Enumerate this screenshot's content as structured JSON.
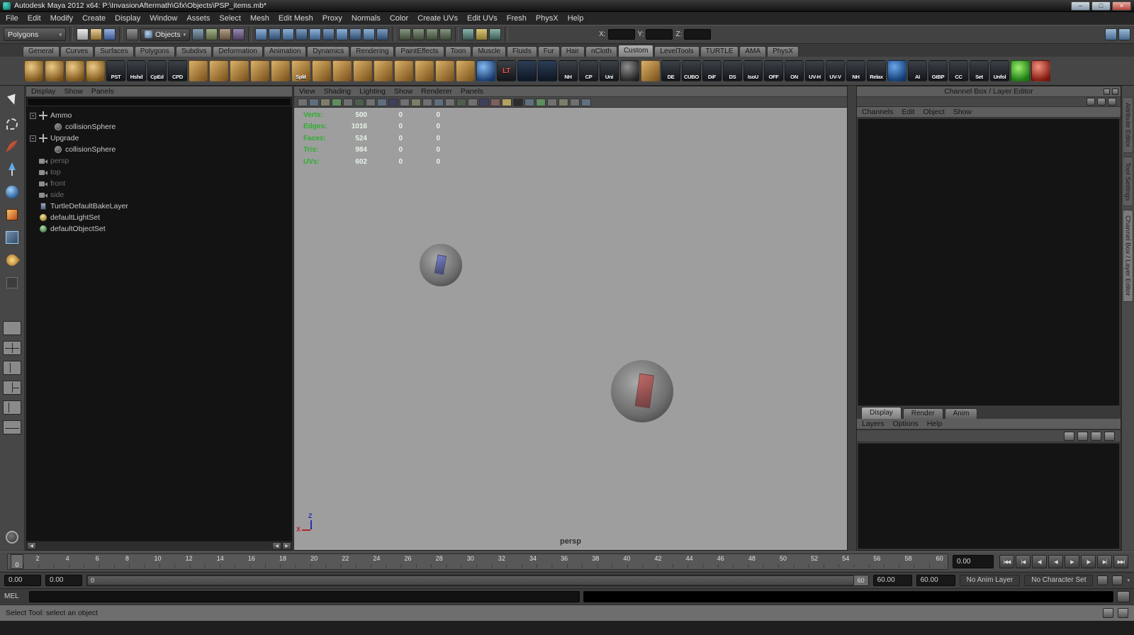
{
  "window": {
    "title": "Autodesk Maya 2012 x64: P:\\InvasionAftermath\\Gfx\\Objects\\PSP_items.mb*",
    "buttons": {
      "minimize": "–",
      "maximize": "□",
      "close": "×"
    }
  },
  "menu_bar": [
    "File",
    "Edit",
    "Modify",
    "Create",
    "Display",
    "Window",
    "Assets",
    "Select",
    "Mesh",
    "Edit Mesh",
    "Proxy",
    "Normals",
    "Color",
    "Create UVs",
    "Edit UVs",
    "Fresh",
    "PhysX",
    "Help"
  ],
  "status_line": {
    "menu_set": "Polygons",
    "selection_combo": "Objects",
    "file_icons": [
      "st-new",
      "st-open",
      "st-save"
    ],
    "mode_icons": [
      "st-hier"
    ],
    "mask_icons": [
      "st-mask1",
      "st-mask2",
      "st-mask3",
      "st-mask4"
    ],
    "snap_icons": [
      "st-snap1",
      "st-snap2",
      "st-snap3",
      "st-snap4",
      "st-snap5",
      "st-snap6",
      "st-snap7",
      "st-snap8",
      "st-snap9",
      "st-snap10"
    ],
    "history_icons": [
      "st-hist1",
      "st-hist2",
      "st-hist3",
      "st-hist4"
    ],
    "render_icons": [
      "st-ren1",
      "st-ren2",
      "st-ren3"
    ],
    "coords": [
      {
        "label": "X:"
      },
      {
        "label": "Y:"
      },
      {
        "label": "Z:"
      }
    ],
    "right_icons": [
      "st-side1",
      "st-side2"
    ]
  },
  "shelf": {
    "tabs": [
      {
        "label": "General"
      },
      {
        "label": "Curves"
      },
      {
        "label": "Surfaces"
      },
      {
        "label": "Polygons"
      },
      {
        "label": "Subdivs"
      },
      {
        "label": "Deformation"
      },
      {
        "label": "Animation"
      },
      {
        "label": "Dynamics"
      },
      {
        "label": "Rendering"
      },
      {
        "label": "PaintEffects"
      },
      {
        "label": "Toon"
      },
      {
        "label": "Muscle"
      },
      {
        "label": "Fluids"
      },
      {
        "label": "Fur"
      },
      {
        "label": "Hair"
      },
      {
        "label": "nCloth"
      },
      {
        "label": "Custom",
        "cls": "active"
      },
      {
        "label": "LevelTools"
      },
      {
        "label": "TURTLE"
      },
      {
        "label": "AMA"
      },
      {
        "label": "PhysX"
      }
    ],
    "items": [
      {
        "cls": "sh-ball"
      },
      {
        "cls": "sh-ball"
      },
      {
        "cls": "sh-ball"
      },
      {
        "cls": "sh-ball"
      },
      {
        "cls": "sh-dark",
        "label": "PST"
      },
      {
        "cls": "sh-dark",
        "label": "Hshd"
      },
      {
        "cls": "sh-dark",
        "label": "CpEd"
      },
      {
        "cls": "sh-dark",
        "label": "CPD"
      },
      {
        "cls": "sh-gold"
      },
      {
        "cls": "sh-gold"
      },
      {
        "cls": "sh-gold"
      },
      {
        "cls": "sh-gold"
      },
      {
        "cls": "sh-gold"
      },
      {
        "cls": "sh-gold",
        "label": "Split"
      },
      {
        "cls": "sh-gold"
      },
      {
        "cls": "sh-gold"
      },
      {
        "cls": "sh-gold"
      },
      {
        "cls": "sh-gold"
      },
      {
        "cls": "sh-gold"
      },
      {
        "cls": "sh-gold"
      },
      {
        "cls": "sh-gold"
      },
      {
        "cls": "sh-gold"
      },
      {
        "cls": "sh-blueball"
      },
      {
        "cls": "sh-dark red-label",
        "label": "LT"
      },
      {
        "cls": "sh-navy"
      },
      {
        "cls": "sh-navy"
      },
      {
        "cls": "sh-dark",
        "label": "NH"
      },
      {
        "cls": "sh-dark",
        "label": "CP"
      },
      {
        "cls": "sh-dark",
        "label": "Uni"
      },
      {
        "cls": "sh-darkball"
      },
      {
        "cls": "sh-gold"
      },
      {
        "cls": "sh-dark",
        "label": "DE"
      },
      {
        "cls": "sh-dark",
        "label": "CUBO"
      },
      {
        "cls": "sh-dark",
        "label": "DiF"
      },
      {
        "cls": "sh-dark",
        "label": "DS"
      },
      {
        "cls": "sh-dark",
        "label": "IsoU"
      },
      {
        "cls": "sh-dark",
        "label": "OFF"
      },
      {
        "cls": "sh-dark",
        "label": "ON"
      },
      {
        "cls": "sh-dark",
        "label": "UV-H"
      },
      {
        "cls": "sh-dark",
        "label": "UV-V"
      },
      {
        "cls": "sh-dark",
        "label": "NH"
      },
      {
        "cls": "sh-dark",
        "label": "Relax"
      },
      {
        "cls": "sh-bluetool"
      },
      {
        "cls": "sh-dark",
        "label": "AI"
      },
      {
        "cls": "sh-dark",
        "label": "GtBP"
      },
      {
        "cls": "sh-dark",
        "label": "CC"
      },
      {
        "cls": "sh-dark",
        "label": "Set"
      },
      {
        "cls": "sh-dark",
        "label": "Unfol"
      },
      {
        "cls": "sh-greenx"
      },
      {
        "cls": "sh-redball"
      }
    ]
  },
  "toolbox": {
    "tools": [
      "tb-arrow",
      "tb-lasso",
      "tb-brush",
      "tb-move",
      "tb-rotate",
      "tb-scale",
      "tb-universal",
      "tb-softmod",
      "tb-last"
    ],
    "layouts": [
      "lay-single",
      "lay-four",
      "lay-split2",
      "lay-split3",
      "lay-outliner",
      "lay-graph"
    ]
  },
  "outliner": {
    "menus": [
      "Display",
      "Show",
      "Panels"
    ],
    "tree": [
      {
        "rowcls": "",
        "exp": "-",
        "icon": "ti-transform",
        "label": "Ammo",
        "labcls": ""
      },
      {
        "rowcls": "ind1 noexp",
        "exp": "",
        "icon": "ti-sphere",
        "label": "collisionSphere",
        "labcls": ""
      },
      {
        "rowcls": "",
        "exp": "-",
        "icon": "ti-transform",
        "label": "Upgrade",
        "labcls": ""
      },
      {
        "rowcls": "ind1 noexp",
        "exp": "",
        "icon": "ti-sphere",
        "label": "collisionSphere",
        "labcls": ""
      },
      {
        "rowcls": "noexp",
        "exp": "",
        "icon": "ti-camera",
        "label": "persp",
        "labcls": "grayed"
      },
      {
        "rowcls": "noexp",
        "exp": "",
        "icon": "ti-camera",
        "label": "top",
        "labcls": "grayed"
      },
      {
        "rowcls": "noexp",
        "exp": "",
        "icon": "ti-camera",
        "label": "front",
        "labcls": "grayed"
      },
      {
        "rowcls": "noexp",
        "exp": "",
        "icon": "ti-camera",
        "label": "side",
        "labcls": "grayed"
      },
      {
        "rowcls": "noexp",
        "exp": "",
        "icon": "ti-layer",
        "label": "TurtleDefaultBakeLayer",
        "labcls": ""
      },
      {
        "rowcls": "noexp",
        "exp": "",
        "icon": "ti-lightset",
        "label": "defaultLightSet",
        "labcls": ""
      },
      {
        "rowcls": "noexp",
        "exp": "",
        "icon": "ti-objectset",
        "label": "defaultObjectSet",
        "labcls": ""
      }
    ]
  },
  "viewport": {
    "menus": [
      "View",
      "Shading",
      "Lighting",
      "Show",
      "Renderer",
      "Panels"
    ],
    "toolbar_icons": [
      "vt-a",
      "vt-b",
      "vt-c",
      "vt-g",
      "vt-a",
      "vt-d",
      "vt-a",
      "vt-b",
      "vt-e",
      "vt-a",
      "vt-c",
      "vt-a",
      "vt-b",
      "vt-a",
      "vt-d",
      "vt-a",
      "vt-e",
      "vt-f",
      "vt-y",
      "vt-k",
      "vt-b",
      "vt-g",
      "vt-a",
      "vt-c",
      "vt-a",
      "vt-b"
    ],
    "hud_rows": [
      {
        "label": "Verts:",
        "a": "500",
        "b": "0",
        "c": "0"
      },
      {
        "label": "Edges:",
        "a": "1016",
        "b": "0",
        "c": "0"
      },
      {
        "label": "Faces:",
        "a": "524",
        "b": "0",
        "c": "0"
      },
      {
        "label": "Tris:",
        "a": "984",
        "b": "0",
        "c": "0"
      },
      {
        "label": "UVs:",
        "a": "602",
        "b": "0",
        "c": "0"
      }
    ],
    "axis": {
      "x": "X",
      "z": "Z"
    },
    "camera_label": "persp"
  },
  "channel_box": {
    "title": "Channel Box / Layer Editor",
    "menus": [
      "Channels",
      "Edit",
      "Object",
      "Show"
    ],
    "layer_editor": {
      "tabs": [
        {
          "label": "Display",
          "cls": "active"
        },
        {
          "label": "Render"
        },
        {
          "label": "Anim"
        }
      ],
      "menus": [
        "Layers",
        "Options",
        "Help"
      ],
      "icons": [
        "le-1",
        "le-2",
        "le-3",
        "le-4"
      ]
    }
  },
  "right_tabs": [
    {
      "label": "Attribute Editor"
    },
    {
      "label": "Tool Settings"
    },
    {
      "label": "Channel Box / Layer Editor",
      "cls": "active"
    }
  ],
  "timeline": {
    "playhead": "0",
    "labels": [
      "2",
      "4",
      "6",
      "8",
      "10",
      "12",
      "14",
      "16",
      "18",
      "20",
      "22",
      "24",
      "26",
      "28",
      "30",
      "32",
      "34",
      "36",
      "38",
      "40",
      "42",
      "44",
      "46",
      "48",
      "50",
      "52",
      "54",
      "56",
      "58",
      "60"
    ],
    "current_time": "0.00",
    "transport": [
      "|◀◀",
      "|◀",
      "◀|",
      "◀",
      "▶",
      "|▶",
      "▶|",
      "▶▶|"
    ]
  },
  "range_slider": {
    "anim_start": "0.00",
    "play_start": "0.00",
    "bar_start": "0",
    "bar_end": "60",
    "play_end": "60.00",
    "anim_end": "60.00",
    "anim_layer": "No Anim Layer",
    "character_set": "No Character Set"
  },
  "command_line": {
    "label": "MEL"
  },
  "help_line": {
    "text": "Select Tool: select an object"
  }
}
